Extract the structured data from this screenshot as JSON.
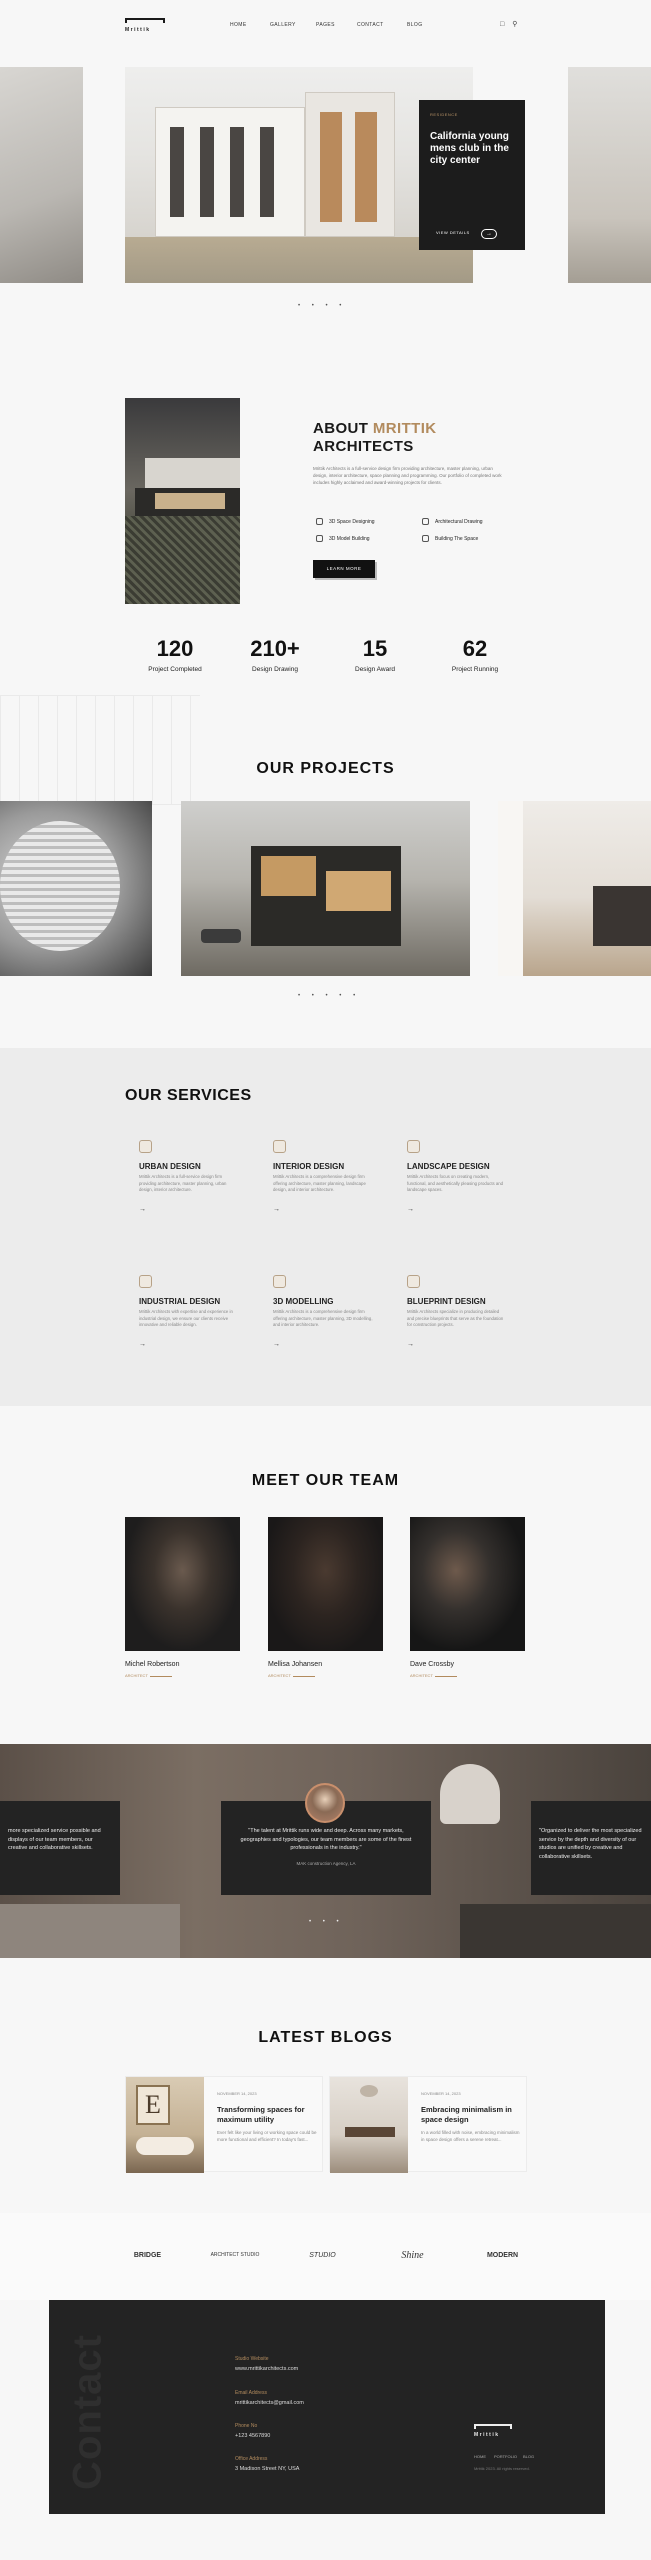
{
  "header": {
    "logo_text": "Mrittik",
    "nav": [
      "HOME",
      "GALLERY",
      "PAGES",
      "CONTACT",
      "BLOG"
    ],
    "cart_icon": "bag-icon",
    "search_icon": "search-icon"
  },
  "hero": {
    "card_tag": "RESIDENCE",
    "card_title": "California young mens club in the city center",
    "card_link": "VIEW DETAILS",
    "dots": "• • • •"
  },
  "about": {
    "title_prefix": "ABOUT",
    "title_accent": "MRITTIK",
    "title_line2": "ARCHITECTS",
    "description": "Mrittik Architects is a full-service design firm providing architecture, master planning, urban design, interior architecture, space planning and programming. Our portfolio of completed work includes highly acclaimed and award-winning projects for clients.",
    "features": [
      "3D Space Designing",
      "Architectural Drawing",
      "3D Model Building",
      "Building The Space"
    ],
    "button": "LEARN MORE"
  },
  "stats": [
    {
      "number": "120",
      "label": "Project Completed"
    },
    {
      "number": "210+",
      "label": "Design Drawing"
    },
    {
      "number": "15",
      "label": "Design Award"
    },
    {
      "number": "62",
      "label": "Project Running"
    }
  ],
  "projects": {
    "title": "OUR PROJECTS",
    "dots": "• • • • •"
  },
  "services": {
    "title": "OUR SERVICES",
    "items": [
      {
        "name": "URBAN DESIGN",
        "desc": "Mrittik Architects is a full-service design firm providing architecture, master planning, urban design, interior architecture."
      },
      {
        "name": "INTERIOR DESIGN",
        "desc": "Mrittik Architects is a comprehensive design firm offering architecture, master planning, landscape design, and interior architecture."
      },
      {
        "name": "LANDSCAPE DESIGN",
        "desc": "Mrittik Architects focus on creating modern, functional, and aesthetically pleasing products and landscape spaces."
      },
      {
        "name": "INDUSTRIAL DESIGN",
        "desc": "Mrittik Architects with expertise and experience in industrial design, we ensure our clients receive innovative and reliable design."
      },
      {
        "name": "3D MODELLING",
        "desc": "Mrittik Architects is a comprehensive design firm offering architecture, master planning, 3D modelling, and interior architecture."
      },
      {
        "name": "BLUEPRINT DESIGN",
        "desc": "Mrittik Architects specialize in producing detailed and precise blueprints that serve as the foundation for construction projects."
      }
    ]
  },
  "team": {
    "title": "MEET OUR TEAM",
    "members": [
      {
        "name": "Michel Robertson",
        "role": "ARCHITECT"
      },
      {
        "name": "Mellisa Johansen",
        "role": "ARCHITECT"
      },
      {
        "name": "Dave Crossby",
        "role": "ARCHITECT"
      }
    ]
  },
  "testimonials": {
    "left_quote": "more specialized service possible and displays of our team members, our creative and collaborative skillsets.",
    "main_quote": "\"The talent at Mrittik runs wide and deep. Across many markets, geographies and typologies, our team members are some of the finest professionals in the industry.\"",
    "main_by": "MAK construction Agency, LA",
    "right_quote": "\"Organized to deliver the most specialized service by the depth and diversity of our studios are unified by creative and collaborative skillsets.",
    "dots": "• • •"
  },
  "blogs": {
    "title": "LATEST BLOGS",
    "items": [
      {
        "date": "NOVEMBER 14, 2023",
        "title": "Transforming spaces for maximum utility",
        "desc": "Ever felt like your living or working space could be more functional and efficient? In today's fast..."
      },
      {
        "date": "NOVEMBER 14, 2023",
        "title": "Embracing minimalism in space design",
        "desc": "In a world filled with noise, embracing minimalism in space design offers a serene retreat..."
      }
    ]
  },
  "partners": [
    "BRIDGE",
    "ARCHITECT STUDIO",
    "STUDIO",
    "Shine",
    "MODERN"
  ],
  "footer": {
    "big": "Contact",
    "studio_label": "Studio Website",
    "studio_value": "www.mrittikarchitects.com",
    "email_label": "Email Address",
    "email_value": "mrittikarchitects@gmail.com",
    "phone_label": "Phone No",
    "phone_value": "+123 4567890",
    "office_label": "Office Address",
    "office_value": "3 Madison Street NY, USA",
    "logo_text": "Mrittik",
    "links": [
      "HOME",
      "PORTFOLIO",
      "BLOG"
    ],
    "copyright": "Mrittik 2023. All rights reserved."
  },
  "colors": {
    "accent": "#b28b5e",
    "dark": "#232323",
    "background": "#f7f7f7"
  }
}
